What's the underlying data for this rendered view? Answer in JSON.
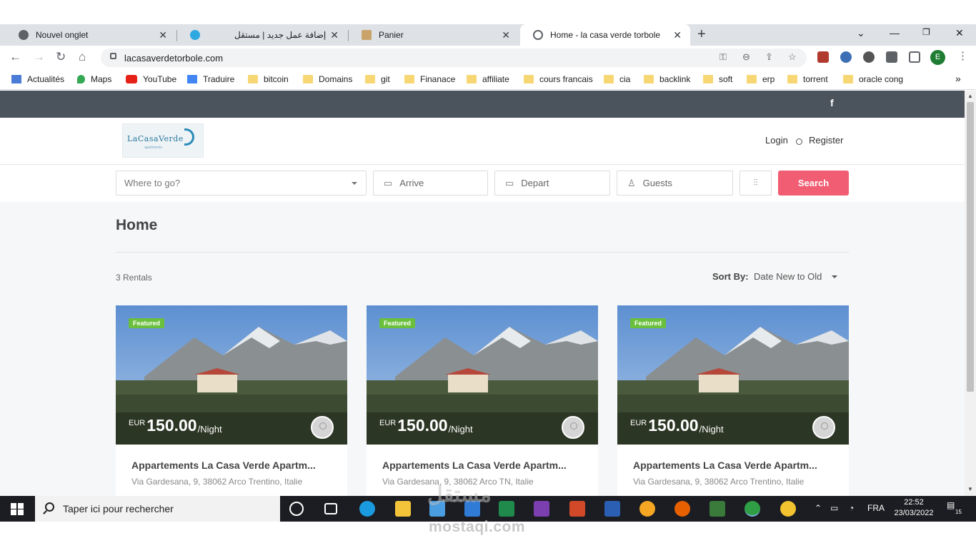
{
  "browser": {
    "tabs": [
      {
        "label": "Nouvel onglet",
        "close": "✕"
      },
      {
        "label": "إضافة عمل جديد | مستقل",
        "close": "✕"
      },
      {
        "label": "Panier",
        "close": "✕"
      },
      {
        "label": "Home - la casa verde torbole",
        "close": "✕"
      }
    ],
    "new_tab": "+",
    "url": "lacasaverdetorbole.com",
    "profile_initial": "E",
    "bookmarks": [
      "Actualités",
      "Maps",
      "YouTube",
      "Traduire",
      "bitcoin",
      "Domains",
      "git",
      "Finanace",
      "affiliate",
      "cours francais",
      "cia",
      "backlink",
      "soft",
      "erp",
      "torrent",
      "oracle cong"
    ],
    "bookmarks_more": "»"
  },
  "site": {
    "logo_text": "LaCasaVerde",
    "logo_sub": "apartments",
    "social": "f",
    "login": "Login",
    "register": "Register",
    "search": {
      "where_placeholder": "Where to go?",
      "arrive": "Arrive",
      "depart": "Depart",
      "guests": "Guests",
      "button": "Search"
    },
    "page_title": "Home",
    "rentals_count": "3 Rentals",
    "sort_label": "Sort By:",
    "sort_value": "Date New to Old",
    "listings": [
      {
        "badge": "Featured",
        "currency": "EUR",
        "price": "150.00",
        "per": "/Night",
        "title": "Appartements La Casa Verde Apartm...",
        "address": "Via Gardesana, 9, 38062 Arco Trentino, Italie"
      },
      {
        "badge": "Featured",
        "currency": "EUR",
        "price": "150.00",
        "per": "/Night",
        "title": "Appartements La Casa Verde Apartm...",
        "address": "Via Gardesana, 9, 38062 Arco TN, Italie"
      },
      {
        "badge": "Featured",
        "currency": "EUR",
        "price": "150.00",
        "per": "/Night",
        "title": "Appartements La Casa Verde Apartm...",
        "address": "Via Gardesana, 9, 38062 Arco Trentino, Italie"
      }
    ]
  },
  "taskbar": {
    "search_placeholder": "Taper ici pour rechercher",
    "language": "FRA",
    "time": "22:52",
    "date": "23/03/2022",
    "notifications": "15"
  },
  "watermark": {
    "latin": "mostaqi.com",
    "arabic": "مستقل"
  },
  "colors": {
    "accent": "#f15d72",
    "topbar": "#4b545c",
    "featured": "#6ac03c",
    "taskbar": "#1c1d22"
  }
}
